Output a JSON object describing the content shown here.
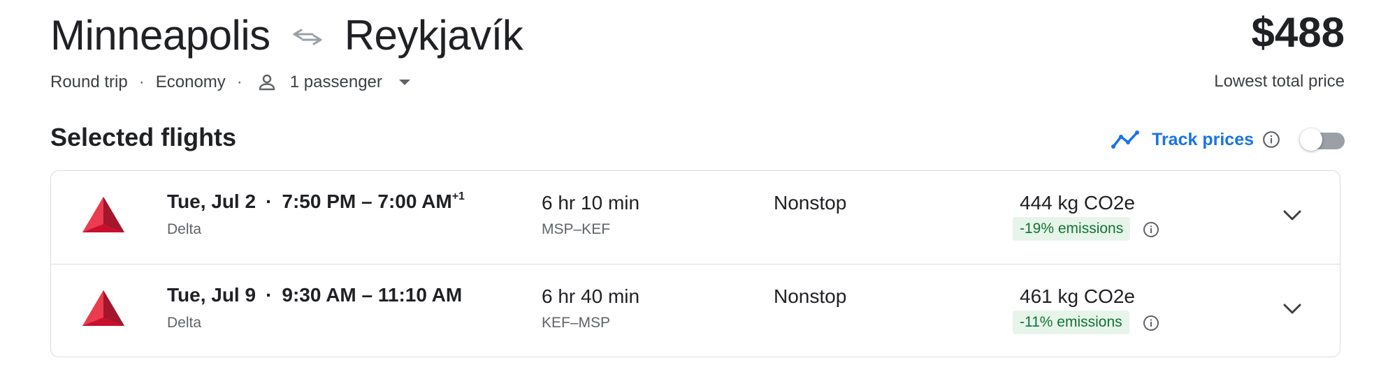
{
  "route": {
    "origin": "Minneapolis",
    "destination": "Reykjavík",
    "swap_icon": "swap-arrows-icon"
  },
  "price": {
    "amount": "$488",
    "label": "Lowest total price"
  },
  "trip_options": {
    "trip_type": "Round trip",
    "separator": "·",
    "cabin": "Economy",
    "passengers": "1 passenger",
    "person_icon": "person-icon",
    "dropdown_icon": "caret-down-icon"
  },
  "selected": {
    "title": "Selected flights",
    "track_prices_label": "Track prices",
    "track_icon": "trend-line-icon",
    "info_icon": "info-icon",
    "track_toggle_on": false,
    "accent_color": "#1a73e8"
  },
  "flights": [
    {
      "date": "Tue, Jul 2",
      "depart": "7:50 PM",
      "dash": "–",
      "arrive": "7:00 AM",
      "day_offset": "+1",
      "airline": "Delta",
      "duration": "6 hr 10 min",
      "airports": "MSP–KEF",
      "stops": "Nonstop",
      "emissions": "444 kg CO2e",
      "emissions_delta": "-19% emissions"
    },
    {
      "date": "Tue, Jul 9",
      "depart": "9:30 AM",
      "dash": "–",
      "arrive": "11:10 AM",
      "day_offset": "",
      "airline": "Delta",
      "duration": "6 hr 40 min",
      "airports": "KEF–MSP",
      "stops": "Nonstop",
      "emissions": "461 kg CO2e",
      "emissions_delta": "-11% emissions"
    }
  ],
  "colors": {
    "emissions_badge_bg": "#e6f4ea",
    "emissions_badge_text": "#137333",
    "delta_red": "#c8102e"
  }
}
